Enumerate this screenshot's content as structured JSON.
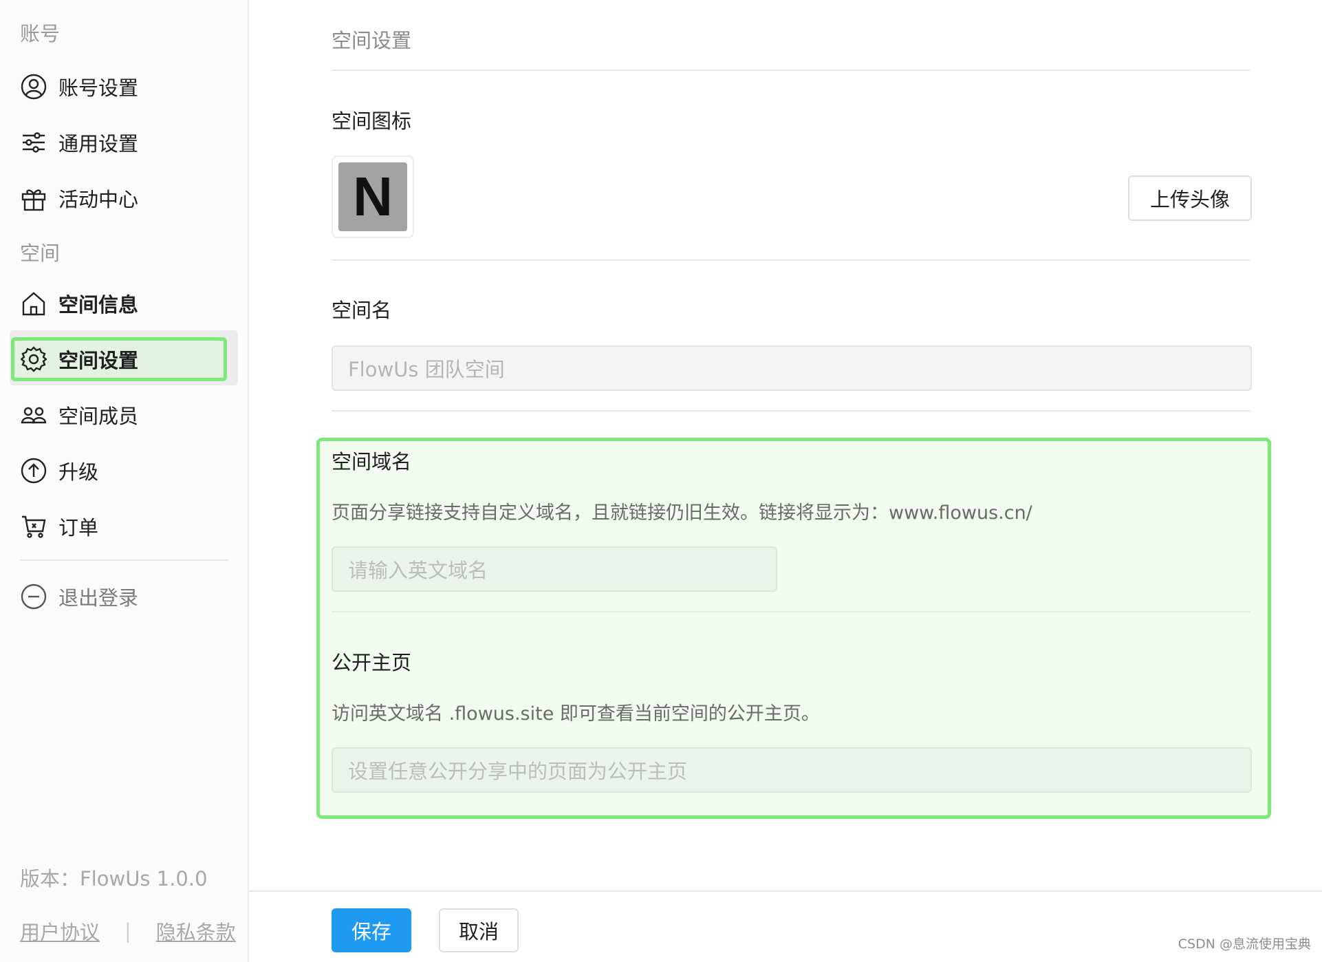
{
  "sidebar": {
    "account_section": "账号",
    "account_items": [
      {
        "label": "账号设置",
        "icon": "user-circle-icon"
      },
      {
        "label": "通用设置",
        "icon": "sliders-icon"
      },
      {
        "label": "活动中心",
        "icon": "gift-icon"
      }
    ],
    "space_section": "空间",
    "space_items": [
      {
        "label": "空间信息",
        "icon": "home-icon"
      },
      {
        "label": "空间设置",
        "icon": "gear-icon",
        "active": true
      },
      {
        "label": "空间成员",
        "icon": "users-icon"
      },
      {
        "label": "升级",
        "icon": "arrow-up-circle-icon"
      },
      {
        "label": "订单",
        "icon": "cart-icon"
      }
    ],
    "logout_label": "退出登录",
    "version": "版本：FlowUs 1.0.0",
    "user_agreement": "用户协议",
    "privacy": "隐私条款"
  },
  "main": {
    "header": "空间设置",
    "icon_section": {
      "title": "空间图标",
      "icon_letter": "N",
      "upload_label": "上传头像"
    },
    "name_section": {
      "title": "空间名",
      "placeholder": "FlowUs 团队空间"
    },
    "domain_section": {
      "title": "空间域名",
      "help": "页面分享链接支持自定义域名，且就链接仍旧生效。链接将显示为：www.flowus.cn/",
      "placeholder": "请输入英文域名"
    },
    "homepage_section": {
      "title": "公开主页",
      "help": "访问英文域名 .flowus.site 即可查看当前空间的公开主页。",
      "placeholder": "设置任意公开分享中的页面为公开主页"
    },
    "save_label": "保存",
    "cancel_label": "取消"
  },
  "watermark": "CSDN @息流使用宝典",
  "colors": {
    "accent": "#1e9bf0",
    "highlight_border": "#7ee87a",
    "highlight_bg": "#f2fbf0"
  }
}
